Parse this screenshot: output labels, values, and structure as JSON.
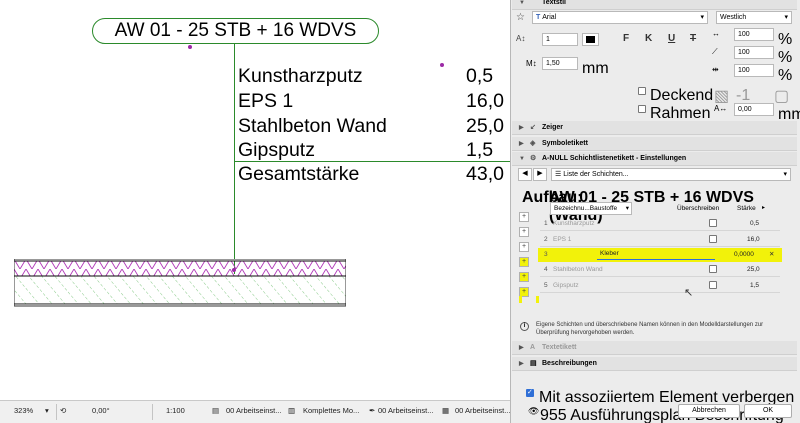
{
  "canvas": {
    "label_title": "AW 01 - 25 STB + 16 WDVS",
    "layers": [
      {
        "name": "Kunstharzputz",
        "value": "0,5"
      },
      {
        "name": "EPS 1",
        "value": "16,0"
      },
      {
        "name": "Stahlbeton Wand",
        "value": "25,0"
      },
      {
        "name": "Gipsputz",
        "value": "1,5"
      },
      {
        "name": "Gesamtstärke",
        "value": "43,0"
      }
    ]
  },
  "statusbar": {
    "zoom": "323%",
    "angle": "0,00°",
    "scale": "1:100",
    "layer_set": "00 Arbeitseinst...",
    "model_view": "Komplettes Mo...",
    "pen_set": "00 Arbeitseinst...",
    "overrides": "00 Arbeitseinst..."
  },
  "panel": {
    "top_section": "Textstil",
    "font": "Arial",
    "script": "Westlich",
    "text_size": "1",
    "width_pct": "100",
    "slant_pct": "100",
    "spacing_pct": "100",
    "percent_unit": "%",
    "line_spacing": "1,50",
    "mm_unit": "mm",
    "bold": "F",
    "italic": "K",
    "underline": "U",
    "strike": "T",
    "opaque_label": "Deckend",
    "opaque_value": "-1",
    "frame_label": "Rahmen",
    "frame_offset": "0,00",
    "frame_unit": "mm",
    "section_pointer": "Zeiger",
    "section_symbol": "Symboletikett",
    "section_settings": "A-NULL Schichtlistenetikett - Einstellungen",
    "list_dropdown": "Liste der Schichten...",
    "buildup_label": "Aufbau:",
    "buildup_name": "AW 01 - 25 STB + 16 WDVS (Wand)",
    "col_name_dropdown": "Bezeichnu...Baustoffe",
    "col_override": "Überschreiben",
    "col_thickness": "Stärke",
    "rows": [
      {
        "num": "1",
        "name": "Kunstharzputz",
        "value": "0,5"
      },
      {
        "num": "2",
        "name": "EPS 1",
        "value": "16,0"
      },
      {
        "num": "3",
        "name": "Kleber",
        "value": "0,0000"
      },
      {
        "num": "4",
        "name": "Stahlbeton Wand",
        "value": "25,0"
      },
      {
        "num": "5",
        "name": "Gipsputz",
        "value": "1,5"
      }
    ],
    "info_text": "Eigene Schichten und überschriebene Namen können in den Modelldarstellungen zur Überprüfung hervorgehoben werden.",
    "section_text_label": "Textetikett",
    "section_descriptions": "Beschreibungen",
    "hide_with_element": "Mit assoziiertem Element verbergen",
    "layer_footer": "955 Ausführungsplan Beschriftung",
    "cancel": "Abbrechen",
    "ok": "OK"
  },
  "colors": {
    "label_green": "#2b8a2b",
    "highlight_yellow": "#f2f20a",
    "purple_hatch": "#b03ab8",
    "concrete_green": "#39a639",
    "accent_blue": "#2f6fd6"
  }
}
